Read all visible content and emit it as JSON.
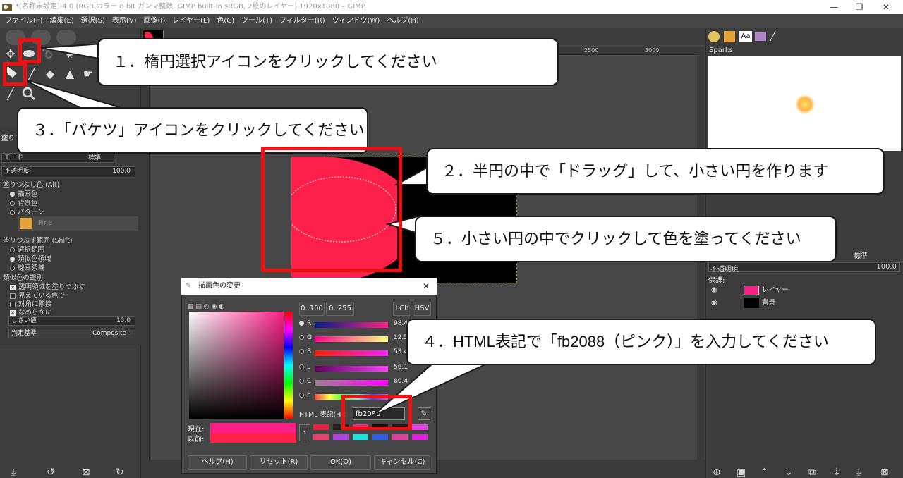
{
  "window": {
    "title": "*[名称未設定]-4.0 (RGB カラー 8 bit ガンマ整数, GIMP built-in sRGB, 2枚のレイヤー) 1920x1080 – GIMP",
    "minimize": "—",
    "maximize": "❐",
    "close": "✕"
  },
  "menu": {
    "items": [
      "ファイル(F)",
      "編集(E)",
      "選択(S)",
      "表示(V)",
      "画像(I)",
      "レイヤー(L)",
      "色(C)",
      "ツール(T)",
      "フィルター(R)",
      "ウィンドウ(W)",
      "ヘルプ(H)"
    ]
  },
  "tool_options": {
    "tab_label": "塗り",
    "mode_label": "モード",
    "mode_value": "標準",
    "opacity_label": "不透明度",
    "opacity_value": "100.0",
    "fill_color_heading": "塗りつぶし色 (Alt)",
    "fill_fg": "描画色",
    "fill_bg": "背景色",
    "fill_pattern": "パターン",
    "pattern_name": "Pine",
    "fill_area_heading": "塗りつぶす範囲 (Shift)",
    "area_selection": "選択範囲",
    "area_similar": "類似色領域",
    "area_line": "線画領域",
    "similar_heading": "類似色の識別",
    "opt_transparent": "透明領域を塗りつぶす",
    "opt_visible": "見えている色で",
    "opt_diagonal": "対角に隣接",
    "opt_antialias": "なめらかに",
    "threshold_label": "しきい値",
    "threshold_value": "15.0",
    "criterion_label": "判定基準",
    "criterion_value": "Composite"
  },
  "ruler": {
    "tick_2500": "2500",
    "tick_3000": "3000"
  },
  "brushes": {
    "name": "Sparks"
  },
  "layers": {
    "mode": "標準",
    "opacity_label": "不透明度",
    "opacity_value": "100.0",
    "lock_label": "保護:",
    "items": [
      {
        "name": "レイヤー",
        "thumb_color": "#fb2088"
      },
      {
        "name": "背景",
        "thumb_color": "#000000"
      }
    ]
  },
  "color_dialog": {
    "title": "描画色の変更",
    "range_100": "0..100",
    "range_255": "0..255",
    "lch": "LCh",
    "hsv": "HSV",
    "sliders": [
      {
        "label": "R",
        "value": "98.4"
      },
      {
        "label": "G",
        "value": "12.5"
      },
      {
        "label": "B",
        "value": "53.4"
      },
      {
        "label": "L",
        "value": "56.1"
      },
      {
        "label": "C",
        "value": "80.4"
      },
      {
        "label": "h",
        "value": ""
      }
    ],
    "html_label": "HTML 表記(H):",
    "html_value": "fb2088",
    "current_label": "現在:",
    "previous_label": "以前:",
    "current_color": "#fb2088",
    "previous_color": "#ff1f4b",
    "history": [
      "#e8233f",
      "#222222",
      "#fb2088",
      "#111111",
      "#1a1a1a",
      "#e040e0",
      "#e84070",
      "#b040e0",
      "#22e0e0",
      "#3060e0",
      "#e040a0",
      "#e020e0"
    ],
    "buttons": {
      "help": "ヘルプ(H)",
      "reset": "リセット(R)",
      "ok": "OK(O)",
      "cancel": "キャンセル(C)"
    }
  },
  "callouts": {
    "step1": "１．楕円選択アイコンをクリックしてください",
    "step2": "２．半円の中で「ドラッグ」して、小さい円を作ります",
    "step3": "３．「バケツ」アイコンをクリックしてください",
    "step4": "４．HTML表記で「fb2088（ピンク）」を入力してください",
    "step5": "５．小さい円の中でクリックして色を塗ってください"
  },
  "colors": {
    "shape_fill": "#ff1f4b",
    "highlight": "#ee1111"
  }
}
